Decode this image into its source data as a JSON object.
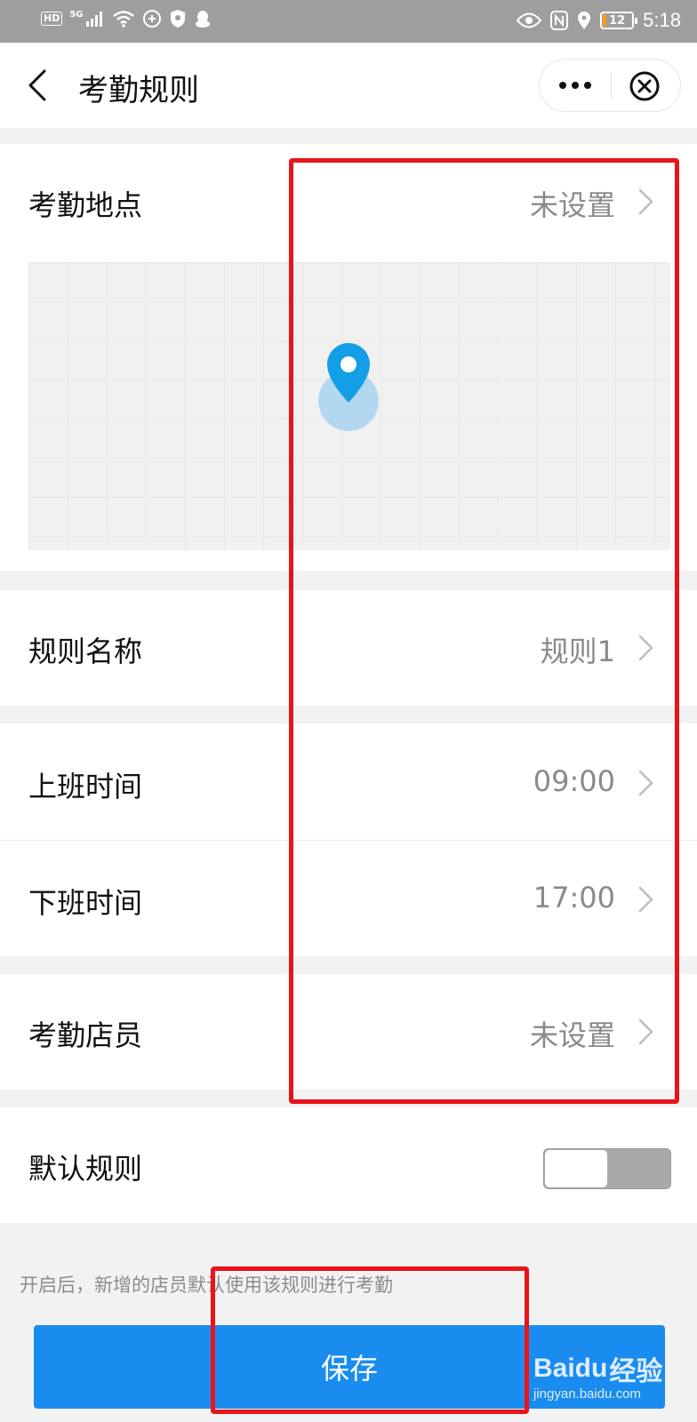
{
  "status_bar": {
    "network_type": "5G",
    "hd_label": "HD",
    "battery_level": "12",
    "time": "5:18",
    "icons": [
      "hd-icon",
      "signal-icon",
      "wifi-icon",
      "data-saver-icon",
      "shield-icon",
      "qq-icon",
      "eye-icon",
      "nfc-icon",
      "location-icon",
      "battery-icon"
    ]
  },
  "header": {
    "title": "考勤规则",
    "back_icon": "chevron-left-icon",
    "more_icon": "more-dots-icon",
    "close_icon": "close-circle-icon"
  },
  "location": {
    "label": "考勤地点",
    "value": "未设置",
    "map_pin_color": "#139ee6"
  },
  "rows": {
    "rule_name": {
      "label": "规则名称",
      "value": "规则1"
    },
    "work_start": {
      "label": "上班时间",
      "value": "09:00"
    },
    "work_end": {
      "label": "下班时间",
      "value": "17:00"
    },
    "staff": {
      "label": "考勤店员",
      "value": "未设置"
    },
    "default_rule": {
      "label": "默认规则",
      "enabled": false
    }
  },
  "hint": "开启后，新增的店员默认使用该规则进行考勤",
  "save_button": {
    "label": "保存",
    "color": "#1a8cef"
  },
  "annotation_color": "#e8141a",
  "watermark": {
    "brand": "Baidu",
    "brand_cn": "经验",
    "url": "jingyan.baidu.com"
  }
}
